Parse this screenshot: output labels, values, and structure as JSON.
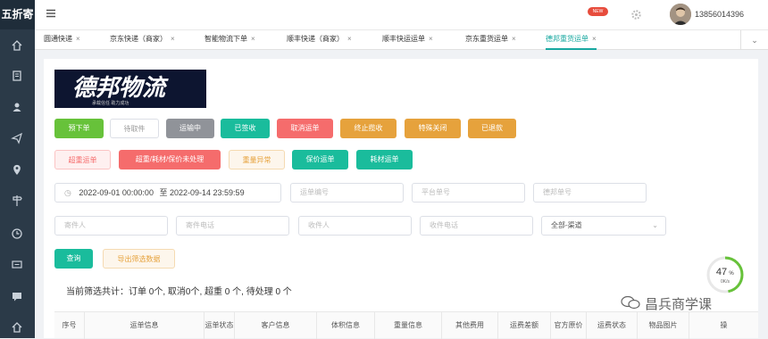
{
  "app": {
    "title": "五折寄"
  },
  "header": {
    "badge": "NEW",
    "username": "13856014396"
  },
  "tabs": [
    {
      "label": "圆通快递",
      "active": false
    },
    {
      "label": "京东快递（商家）",
      "active": false
    },
    {
      "label": "智能物流下单",
      "active": false
    },
    {
      "label": "顺丰快递（商家）",
      "active": false
    },
    {
      "label": "顺丰快运运单",
      "active": false
    },
    {
      "label": "京东重货运单",
      "active": false
    },
    {
      "label": "德邦重货运单",
      "active": true
    }
  ],
  "brand": {
    "logo_text": "德邦物流",
    "slogan": "承载信任 助力成功"
  },
  "status_buttons": [
    {
      "label": "预下单",
      "color": "#67c23a"
    },
    {
      "label": "待取件",
      "color": "#ffffff"
    },
    {
      "label": "运输中",
      "color": "#909399"
    },
    {
      "label": "已签收",
      "color": "#1abc9c"
    },
    {
      "label": "取消运单",
      "color": "#f56c6c"
    },
    {
      "label": "终止揽收",
      "color": "#e6a23c"
    },
    {
      "label": "特殊关闭",
      "color": "#e6a23c"
    },
    {
      "label": "已退款",
      "color": "#e6a23c"
    }
  ],
  "issue_buttons": [
    {
      "label": "超重运单",
      "color": "#fef0f0"
    },
    {
      "label": "超重/耗材/保价未处理",
      "color": "#f56c6c"
    },
    {
      "label": "重量异常",
      "color": "#fdf6ec"
    },
    {
      "label": "保价运单",
      "color": "#1abc9c"
    },
    {
      "label": "耗材运单",
      "color": "#1abc9c"
    }
  ],
  "filters": {
    "date_start": "2022-09-01 00:00:00",
    "date_sep": "至",
    "date_end": "2022-09-14 23:59:59",
    "waybill_no": "运单编号",
    "platform_no": "平台单号",
    "order_no": "德邦单号",
    "sender": "寄件人",
    "sender_phone": "寄件电话",
    "receiver": "收件人",
    "receiver_phone": "收件电话",
    "channel": "全部-渠道"
  },
  "actions": {
    "query": "查询",
    "export": "导出筛选数据"
  },
  "summary": "当前筛选共计：订单 0个, 取消0个, 超重 0 个, 待处理 0 个",
  "table": {
    "columns": [
      "序号",
      "运单信息",
      "运单状态",
      "客户信息",
      "体积信息",
      "重量信息",
      "其他费用",
      "运费差额",
      "官方原价",
      "运费状态",
      "物品图片",
      "操"
    ]
  },
  "gauge": {
    "value": "47",
    "unit": "%",
    "rate": "0K/s",
    "percent": 47
  },
  "watermark": "昌兵商学课"
}
